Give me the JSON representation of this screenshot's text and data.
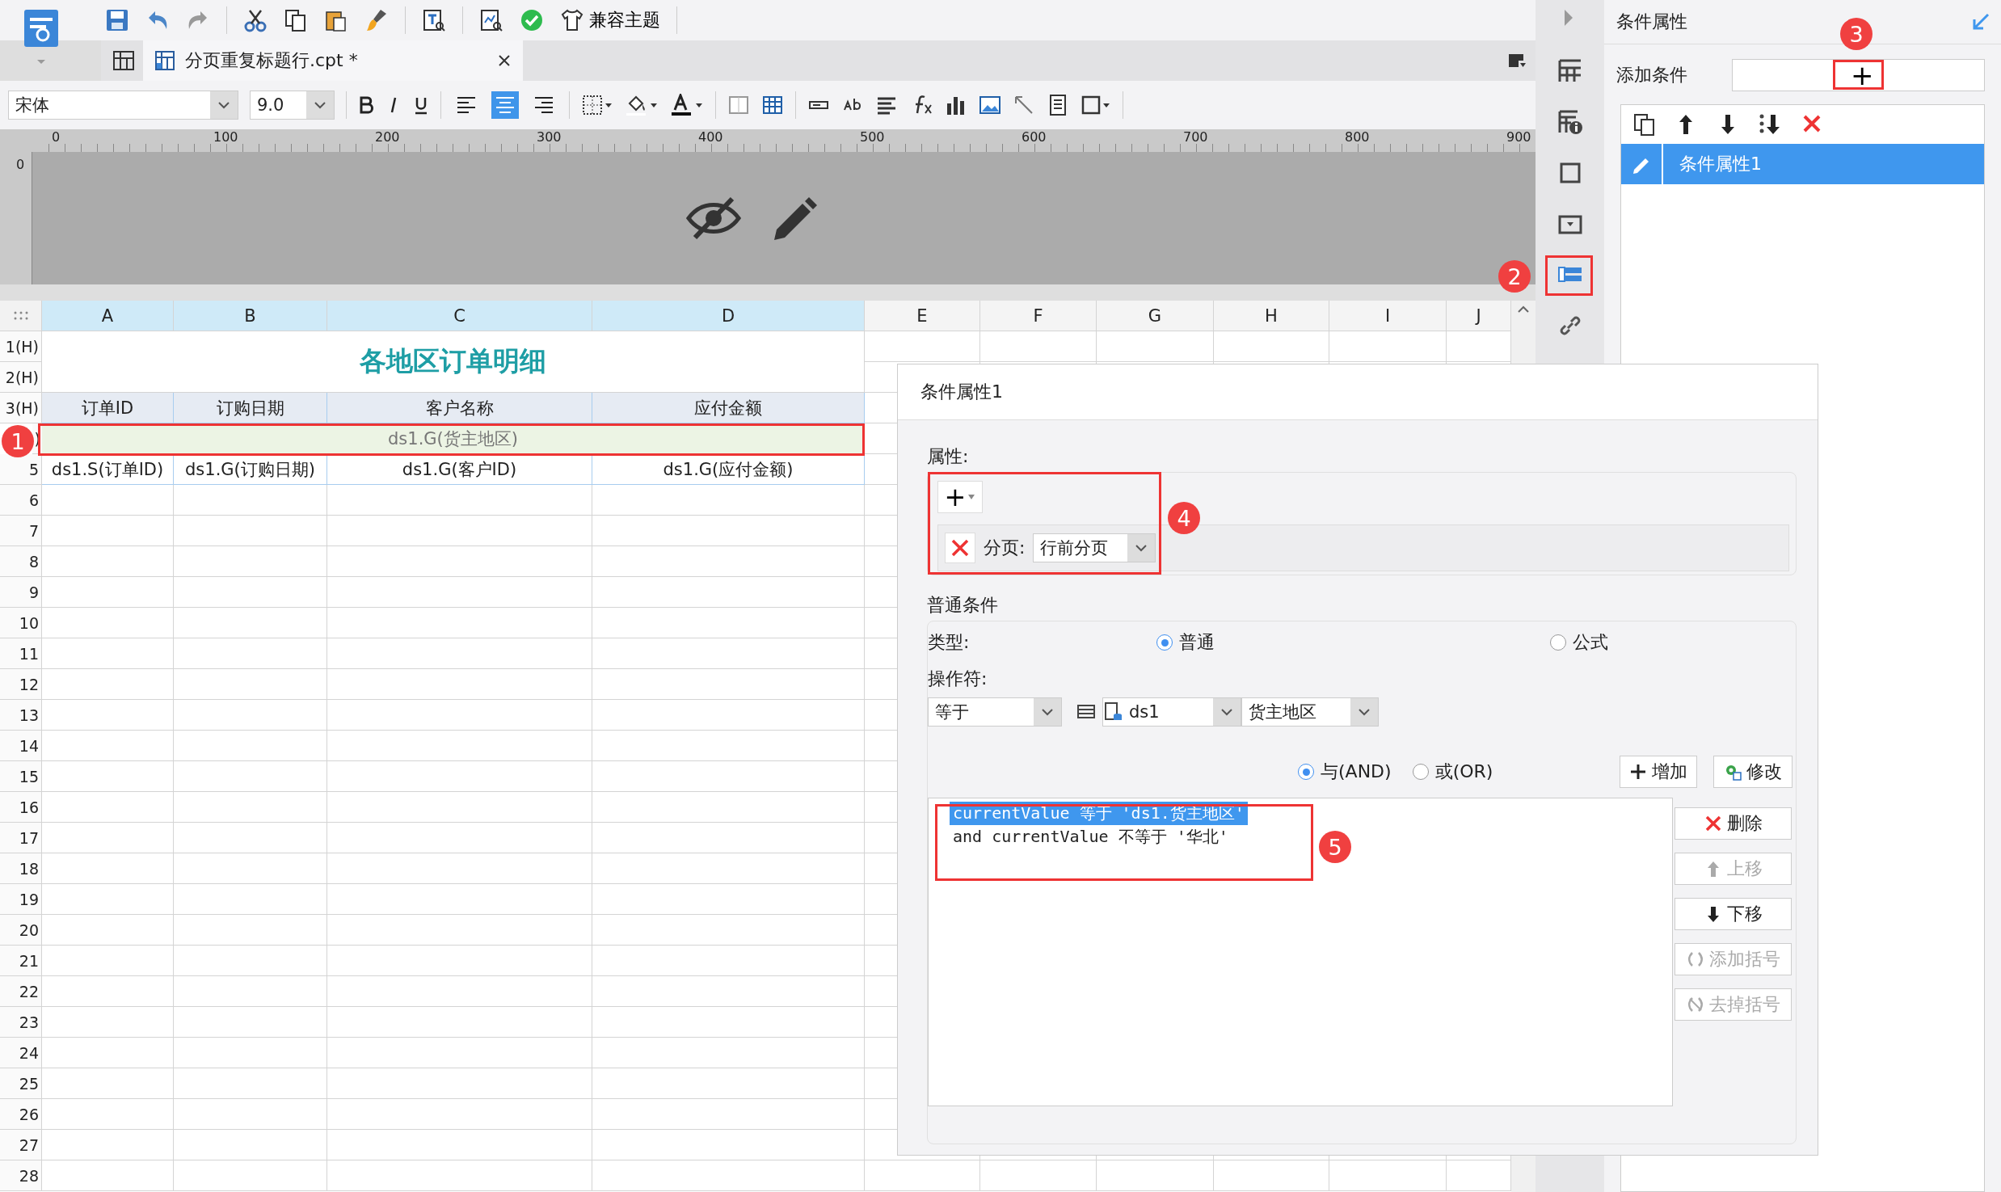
{
  "toolbar": {
    "theme_button": {
      "label": "兼容主题"
    }
  },
  "tabs": [
    {
      "label": "分页重复标题行.cpt *",
      "selected": true
    }
  ],
  "format_bar": {
    "font": "宋体",
    "size": "9.0",
    "alignments": [
      {
        "selected": false
      },
      {
        "selected": true
      },
      {
        "selected": false
      }
    ]
  },
  "ruler": {
    "ticks": [
      "0",
      "100",
      "200",
      "300",
      "400",
      "500",
      "600",
      "700",
      "800",
      "900"
    ],
    "vertical_tick": "0"
  },
  "sheet": {
    "columns": [
      {
        "label": "A",
        "selected": true
      },
      {
        "label": "B",
        "selected": true
      },
      {
        "label": "C",
        "selected": true
      },
      {
        "label": "D",
        "selected": true
      },
      {
        "label": "E",
        "selected": false
      },
      {
        "label": "F",
        "selected": false
      },
      {
        "label": "G",
        "selected": false
      },
      {
        "label": "H",
        "selected": false
      },
      {
        "label": "I",
        "selected": false
      },
      {
        "label": "J",
        "selected": false
      }
    ],
    "row_labels": [
      "1(H)",
      "2(H)",
      "3(H)",
      ")",
      "5",
      "6",
      "7",
      "8",
      "9",
      "10",
      "11",
      "12",
      "13",
      "14",
      "15",
      "16",
      "17",
      "18",
      "19",
      "20",
      "21",
      "22",
      "23",
      "24",
      "25",
      "26",
      "27",
      "28"
    ],
    "title": "各地区订单明细",
    "headers": [
      "订单ID",
      "订购日期",
      "客户名称",
      "应付金额"
    ],
    "group_row": {
      "text": "ds1.G(货主地区)",
      "selected": true
    },
    "data_row": [
      "ds1.S(订单ID)",
      "ds1.G(订购日期)",
      "ds1.G(客户ID)",
      "ds1.G(应付金额)"
    ]
  },
  "side_panel": {
    "title": "条件属性",
    "add_label": "添加条件",
    "add_button": "+",
    "items": [
      {
        "label": "条件属性1",
        "selected": true
      }
    ]
  },
  "dialog": {
    "title": "条件属性1",
    "attributes": {
      "label": "属性:",
      "add_button": "+",
      "rows": [
        {
          "label": "分页:",
          "value": "行前分页"
        }
      ]
    },
    "condition": {
      "label": "普通条件",
      "type_label": "类型:",
      "types": [
        {
          "label": "普通",
          "selected": true
        },
        {
          "label": "公式",
          "selected": false
        }
      ],
      "operator_label": "操作符:",
      "operator": "等于",
      "dataset": "ds1",
      "field": "货主地区",
      "joins": [
        {
          "label": "与(AND)",
          "selected": true
        },
        {
          "label": "或(OR)",
          "selected": false
        }
      ],
      "top_buttons": [
        {
          "label": "增加",
          "kind": "add"
        },
        {
          "label": "修改",
          "kind": "edit"
        }
      ],
      "list": [
        {
          "text": "currentValue 等于 'ds1.货主地区'",
          "selected": true
        },
        {
          "text": "and currentValue 不等于 '华北'",
          "selected": false
        }
      ],
      "side_buttons": [
        {
          "label": "删除",
          "kind": "delete",
          "disabled": false
        },
        {
          "label": "上移",
          "kind": "up",
          "disabled": true
        },
        {
          "label": "下移",
          "kind": "down",
          "disabled": false
        },
        {
          "label": "添加括号",
          "kind": "paren-add",
          "disabled": true
        },
        {
          "label": "去掉括号",
          "kind": "paren-remove",
          "disabled": true
        }
      ]
    }
  },
  "annotations": [
    "1",
    "2",
    "3",
    "4",
    "5"
  ]
}
